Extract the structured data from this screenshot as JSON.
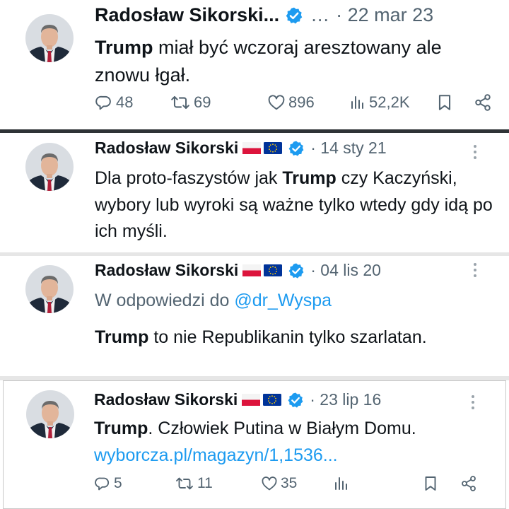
{
  "tweets": [
    {
      "author": "Radosław Sikorski...",
      "more": "…",
      "date": "· 22 mar 23",
      "text_bold": "Trump",
      "text_rest": " miał być wczoraj aresztowany ale znowu łgał.",
      "replies": "48",
      "retweets": "69",
      "likes": "896",
      "views": "52,2K"
    },
    {
      "author": "Radosław Sikorski",
      "date": "· 14 sty 21",
      "text_pre": "Dla proto-faszystów jak ",
      "text_bold": "Trump",
      "text_rest": " czy Kaczyński, wybory lub wyroki są ważne tylko wtedy gdy idą po ich myśli."
    },
    {
      "author": "Radosław Sikorski",
      "date": "· 04 lis 20",
      "reply_prefix": "W odpowiedzi do ",
      "reply_handle": "@dr_Wyspa",
      "text_bold": "Trump",
      "text_rest": " to nie Republikanin tylko szarlatan."
    },
    {
      "author": "Radosław Sikorski",
      "date": "· 23 lip 16",
      "text_bold": "Trump",
      "text_rest": ".  Człowiek Putina w Białym Domu.",
      "link": "wyborcza.pl/magazyn/1,1536...",
      "replies": "5",
      "retweets": "11",
      "likes": "35"
    }
  ],
  "icons": [
    "avatar",
    "verified-badge-icon",
    "flag-pl-icon",
    "flag-eu-icon",
    "more-vertical-icon",
    "reply-icon",
    "retweet-icon",
    "like-icon",
    "views-icon",
    "bookmark-icon",
    "share-icon"
  ],
  "colors": {
    "verified": "#1d9bf0",
    "link": "#1d9bf0",
    "muted": "#536471",
    "text": "#0f1419"
  }
}
